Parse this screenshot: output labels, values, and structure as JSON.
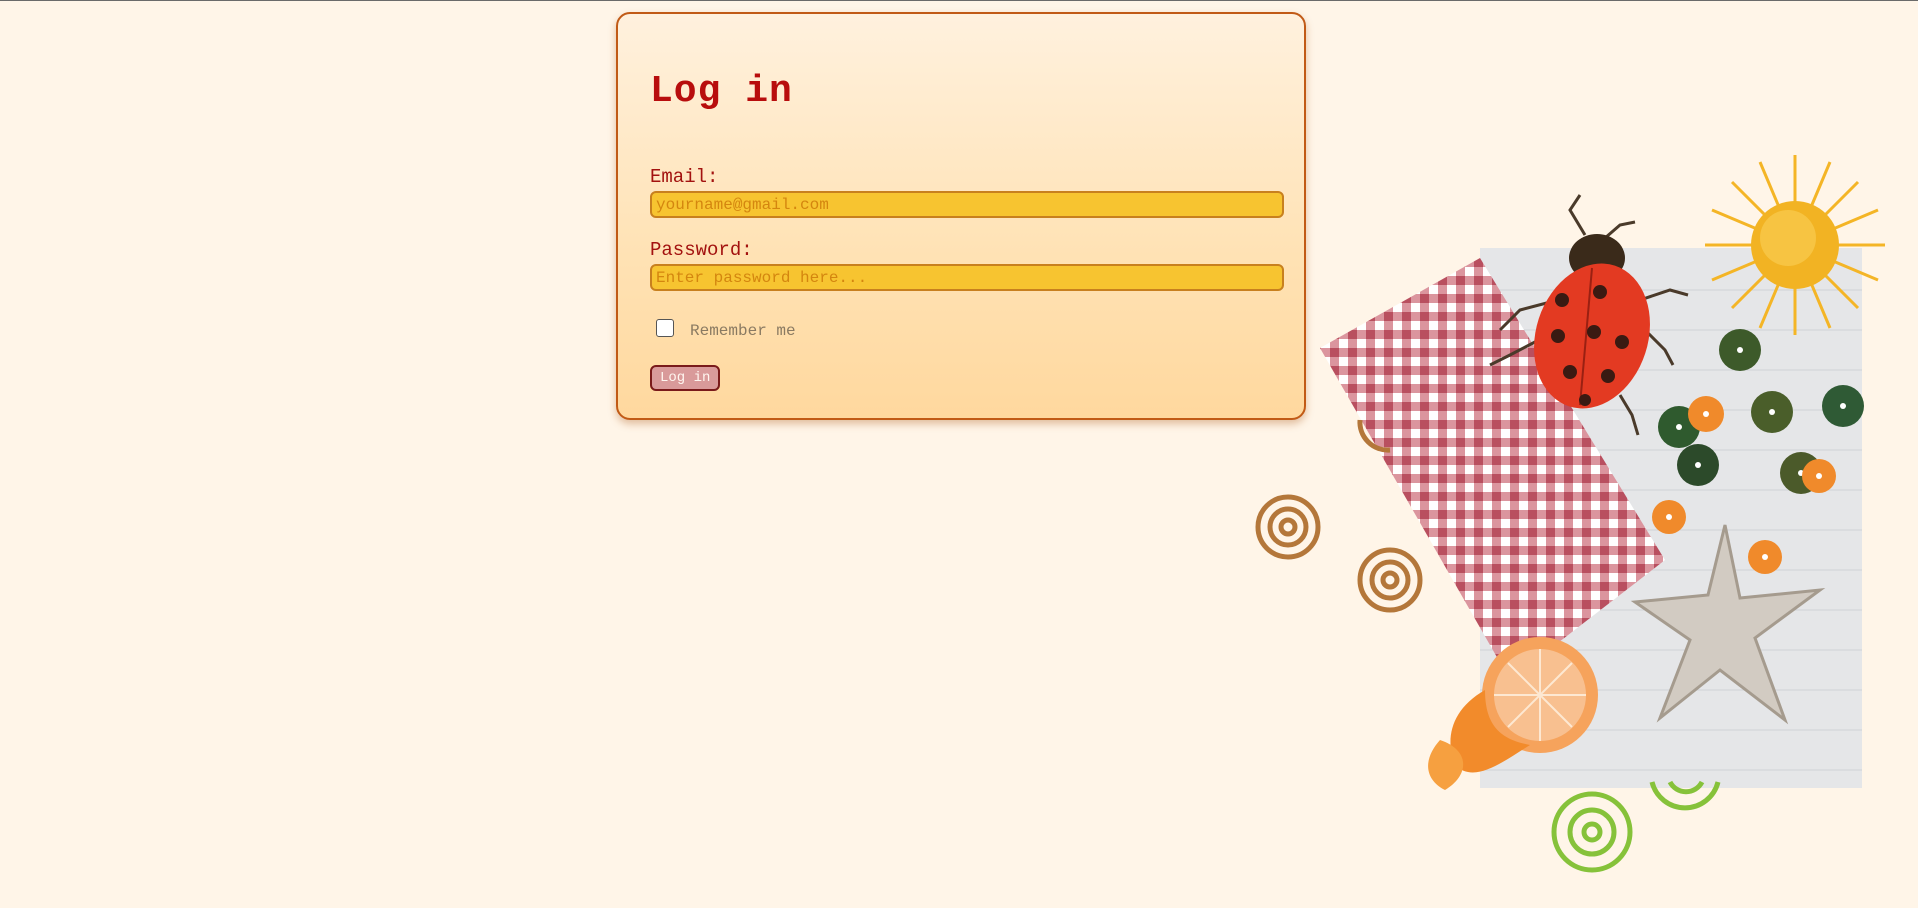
{
  "login": {
    "title": "Log in",
    "email_label": "Email:",
    "email_placeholder": "yourname@gmail.com",
    "email_value": "",
    "password_label": "Password:",
    "password_placeholder": "Enter password here...",
    "password_value": "",
    "remember_label": "Remember me",
    "remember_checked": false,
    "submit_label": "Log in"
  },
  "colors": {
    "background": "#fff5e8",
    "title": "#b80d0d",
    "input_fill": "#f7c430",
    "card_border": "#c15a16",
    "button_fill": "#d99a9a"
  },
  "decoration": {
    "icons": [
      "sun-icon",
      "ladybug-icon",
      "checkered-cloth-icon",
      "sequin-icon",
      "spiral-icon",
      "star-icon",
      "orange-icon",
      "lined-paper-icon"
    ]
  }
}
